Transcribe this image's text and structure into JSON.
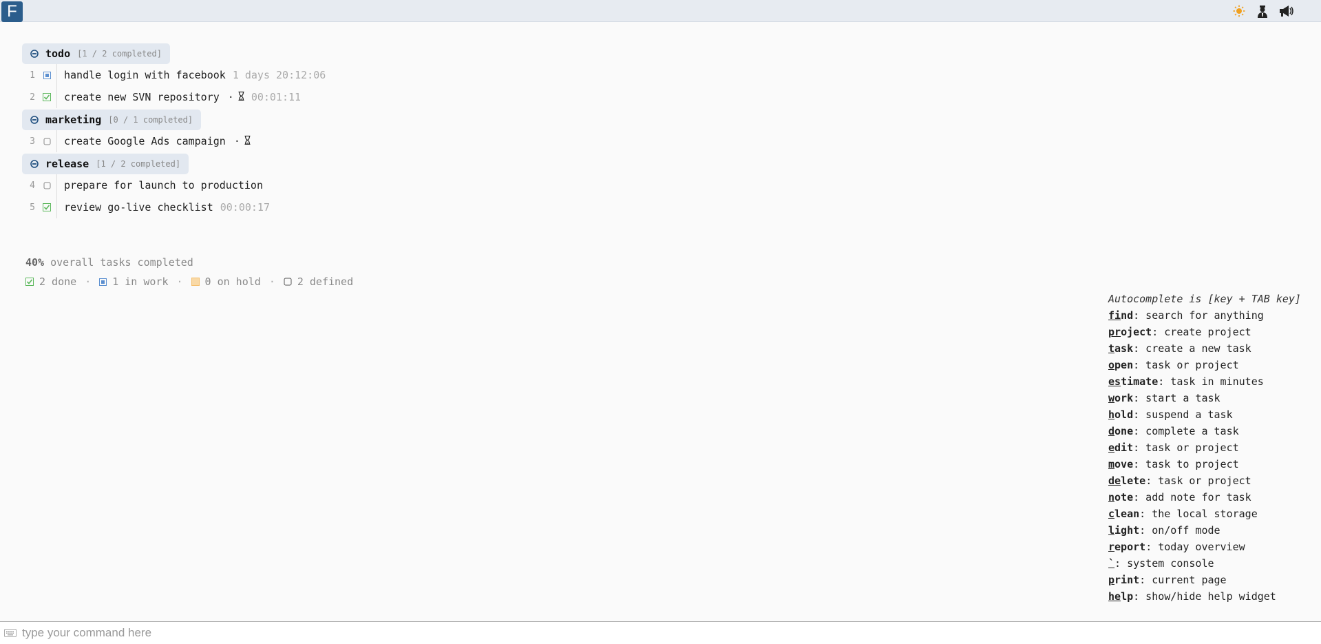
{
  "app": {
    "logo_letter": "F"
  },
  "topbar": {
    "icons": [
      {
        "name": "sun-icon",
        "color": "#f0a020"
      },
      {
        "name": "user-icon",
        "color": "#222"
      },
      {
        "name": "megaphone-icon",
        "color": "#222"
      }
    ]
  },
  "projects": [
    {
      "name": "todo",
      "count": "[1 / 2 completed]",
      "tasks": [
        {
          "num": "1",
          "status": "in-work",
          "name": "handle login with facebook",
          "timer": "1 days 20:12:06",
          "hourglass": false
        },
        {
          "num": "2",
          "status": "done",
          "name": "create new SVN repository",
          "timer": "00:01:11",
          "hourglass": true
        }
      ]
    },
    {
      "name": "marketing",
      "count": "[0 / 1 completed]",
      "tasks": [
        {
          "num": "3",
          "status": "defined",
          "name": "create Google Ads campaign",
          "timer": "",
          "hourglass": true
        }
      ]
    },
    {
      "name": "release",
      "count": "[1 / 2 completed]",
      "tasks": [
        {
          "num": "4",
          "status": "defined",
          "name": "prepare for launch to production",
          "timer": "",
          "hourglass": false
        },
        {
          "num": "5",
          "status": "done",
          "name": "review go-live checklist",
          "timer": "00:00:17",
          "hourglass": false
        }
      ]
    }
  ],
  "summary": {
    "percent": "40%",
    "overall_text": " overall tasks completed",
    "done": "2 done",
    "in_work": "1 in work",
    "on_hold": "0 on hold",
    "defined": "2 defined",
    "separator": "·"
  },
  "help": {
    "title": "Autocomplete is [key + TAB key]",
    "commands": [
      {
        "key": "fi",
        "rest": "nd",
        "desc": ": search for anything"
      },
      {
        "key": "pr",
        "rest": "oject",
        "desc": ": create project"
      },
      {
        "key": "t",
        "rest": "ask",
        "desc": ": create a new task"
      },
      {
        "key": "o",
        "rest": "pen",
        "desc": ": task or project"
      },
      {
        "key": "es",
        "rest": "timate",
        "desc": ": task in minutes"
      },
      {
        "key": "w",
        "rest": "ork",
        "desc": ": start a task"
      },
      {
        "key": "h",
        "rest": "old",
        "desc": ": suspend a task"
      },
      {
        "key": "d",
        "rest": "one",
        "desc": ": complete a task"
      },
      {
        "key": "e",
        "rest": "dit",
        "desc": ": task or project"
      },
      {
        "key": "m",
        "rest": "ove",
        "desc": ": task to project"
      },
      {
        "key": "de",
        "rest": "lete",
        "desc": ": task or project"
      },
      {
        "key": "n",
        "rest": "ote",
        "desc": ": add note for task"
      },
      {
        "key": "c",
        "rest": "lean",
        "desc": ": the local storage"
      },
      {
        "key": "l",
        "rest": "ight",
        "desc": ": on/off mode"
      },
      {
        "key": "r",
        "rest": "eport",
        "desc": ": today overview"
      },
      {
        "key": "`",
        "rest": "",
        "desc": ": system console"
      },
      {
        "key": "p",
        "rest": "rint",
        "desc": ": current page"
      },
      {
        "key": "he",
        "rest": "lp",
        "desc": ": show/hide help widget"
      }
    ]
  },
  "command_bar": {
    "placeholder": "type your command here",
    "value": ""
  },
  "colors": {
    "done": "#5cb85c",
    "in_work": "#5b8fd0",
    "on_hold": "#f5c06f",
    "defined": "#777777",
    "header_bg": "#e2e8f0",
    "logo_bg": "#2b5d8c"
  }
}
